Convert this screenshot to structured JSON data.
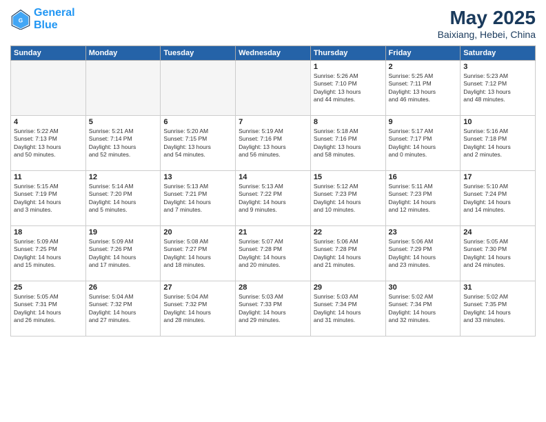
{
  "logo": {
    "line1": "General",
    "line2": "Blue"
  },
  "title": "May 2025",
  "subtitle": "Baixiang, Hebei, China",
  "weekdays": [
    "Sunday",
    "Monday",
    "Tuesday",
    "Wednesday",
    "Thursday",
    "Friday",
    "Saturday"
  ],
  "weeks": [
    [
      {
        "day": "",
        "info": "",
        "empty": true
      },
      {
        "day": "",
        "info": "",
        "empty": true
      },
      {
        "day": "",
        "info": "",
        "empty": true
      },
      {
        "day": "",
        "info": "",
        "empty": true
      },
      {
        "day": "1",
        "info": "Sunrise: 5:26 AM\nSunset: 7:10 PM\nDaylight: 13 hours\nand 44 minutes."
      },
      {
        "day": "2",
        "info": "Sunrise: 5:25 AM\nSunset: 7:11 PM\nDaylight: 13 hours\nand 46 minutes."
      },
      {
        "day": "3",
        "info": "Sunrise: 5:23 AM\nSunset: 7:12 PM\nDaylight: 13 hours\nand 48 minutes."
      }
    ],
    [
      {
        "day": "4",
        "info": "Sunrise: 5:22 AM\nSunset: 7:13 PM\nDaylight: 13 hours\nand 50 minutes."
      },
      {
        "day": "5",
        "info": "Sunrise: 5:21 AM\nSunset: 7:14 PM\nDaylight: 13 hours\nand 52 minutes."
      },
      {
        "day": "6",
        "info": "Sunrise: 5:20 AM\nSunset: 7:15 PM\nDaylight: 13 hours\nand 54 minutes."
      },
      {
        "day": "7",
        "info": "Sunrise: 5:19 AM\nSunset: 7:16 PM\nDaylight: 13 hours\nand 56 minutes."
      },
      {
        "day": "8",
        "info": "Sunrise: 5:18 AM\nSunset: 7:16 PM\nDaylight: 13 hours\nand 58 minutes."
      },
      {
        "day": "9",
        "info": "Sunrise: 5:17 AM\nSunset: 7:17 PM\nDaylight: 14 hours\nand 0 minutes."
      },
      {
        "day": "10",
        "info": "Sunrise: 5:16 AM\nSunset: 7:18 PM\nDaylight: 14 hours\nand 2 minutes."
      }
    ],
    [
      {
        "day": "11",
        "info": "Sunrise: 5:15 AM\nSunset: 7:19 PM\nDaylight: 14 hours\nand 3 minutes."
      },
      {
        "day": "12",
        "info": "Sunrise: 5:14 AM\nSunset: 7:20 PM\nDaylight: 14 hours\nand 5 minutes."
      },
      {
        "day": "13",
        "info": "Sunrise: 5:13 AM\nSunset: 7:21 PM\nDaylight: 14 hours\nand 7 minutes."
      },
      {
        "day": "14",
        "info": "Sunrise: 5:13 AM\nSunset: 7:22 PM\nDaylight: 14 hours\nand 9 minutes."
      },
      {
        "day": "15",
        "info": "Sunrise: 5:12 AM\nSunset: 7:23 PM\nDaylight: 14 hours\nand 10 minutes."
      },
      {
        "day": "16",
        "info": "Sunrise: 5:11 AM\nSunset: 7:23 PM\nDaylight: 14 hours\nand 12 minutes."
      },
      {
        "day": "17",
        "info": "Sunrise: 5:10 AM\nSunset: 7:24 PM\nDaylight: 14 hours\nand 14 minutes."
      }
    ],
    [
      {
        "day": "18",
        "info": "Sunrise: 5:09 AM\nSunset: 7:25 PM\nDaylight: 14 hours\nand 15 minutes."
      },
      {
        "day": "19",
        "info": "Sunrise: 5:09 AM\nSunset: 7:26 PM\nDaylight: 14 hours\nand 17 minutes."
      },
      {
        "day": "20",
        "info": "Sunrise: 5:08 AM\nSunset: 7:27 PM\nDaylight: 14 hours\nand 18 minutes."
      },
      {
        "day": "21",
        "info": "Sunrise: 5:07 AM\nSunset: 7:28 PM\nDaylight: 14 hours\nand 20 minutes."
      },
      {
        "day": "22",
        "info": "Sunrise: 5:06 AM\nSunset: 7:28 PM\nDaylight: 14 hours\nand 21 minutes."
      },
      {
        "day": "23",
        "info": "Sunrise: 5:06 AM\nSunset: 7:29 PM\nDaylight: 14 hours\nand 23 minutes."
      },
      {
        "day": "24",
        "info": "Sunrise: 5:05 AM\nSunset: 7:30 PM\nDaylight: 14 hours\nand 24 minutes."
      }
    ],
    [
      {
        "day": "25",
        "info": "Sunrise: 5:05 AM\nSunset: 7:31 PM\nDaylight: 14 hours\nand 26 minutes."
      },
      {
        "day": "26",
        "info": "Sunrise: 5:04 AM\nSunset: 7:32 PM\nDaylight: 14 hours\nand 27 minutes."
      },
      {
        "day": "27",
        "info": "Sunrise: 5:04 AM\nSunset: 7:32 PM\nDaylight: 14 hours\nand 28 minutes."
      },
      {
        "day": "28",
        "info": "Sunrise: 5:03 AM\nSunset: 7:33 PM\nDaylight: 14 hours\nand 29 minutes."
      },
      {
        "day": "29",
        "info": "Sunrise: 5:03 AM\nSunset: 7:34 PM\nDaylight: 14 hours\nand 31 minutes."
      },
      {
        "day": "30",
        "info": "Sunrise: 5:02 AM\nSunset: 7:34 PM\nDaylight: 14 hours\nand 32 minutes."
      },
      {
        "day": "31",
        "info": "Sunrise: 5:02 AM\nSunset: 7:35 PM\nDaylight: 14 hours\nand 33 minutes."
      }
    ]
  ]
}
